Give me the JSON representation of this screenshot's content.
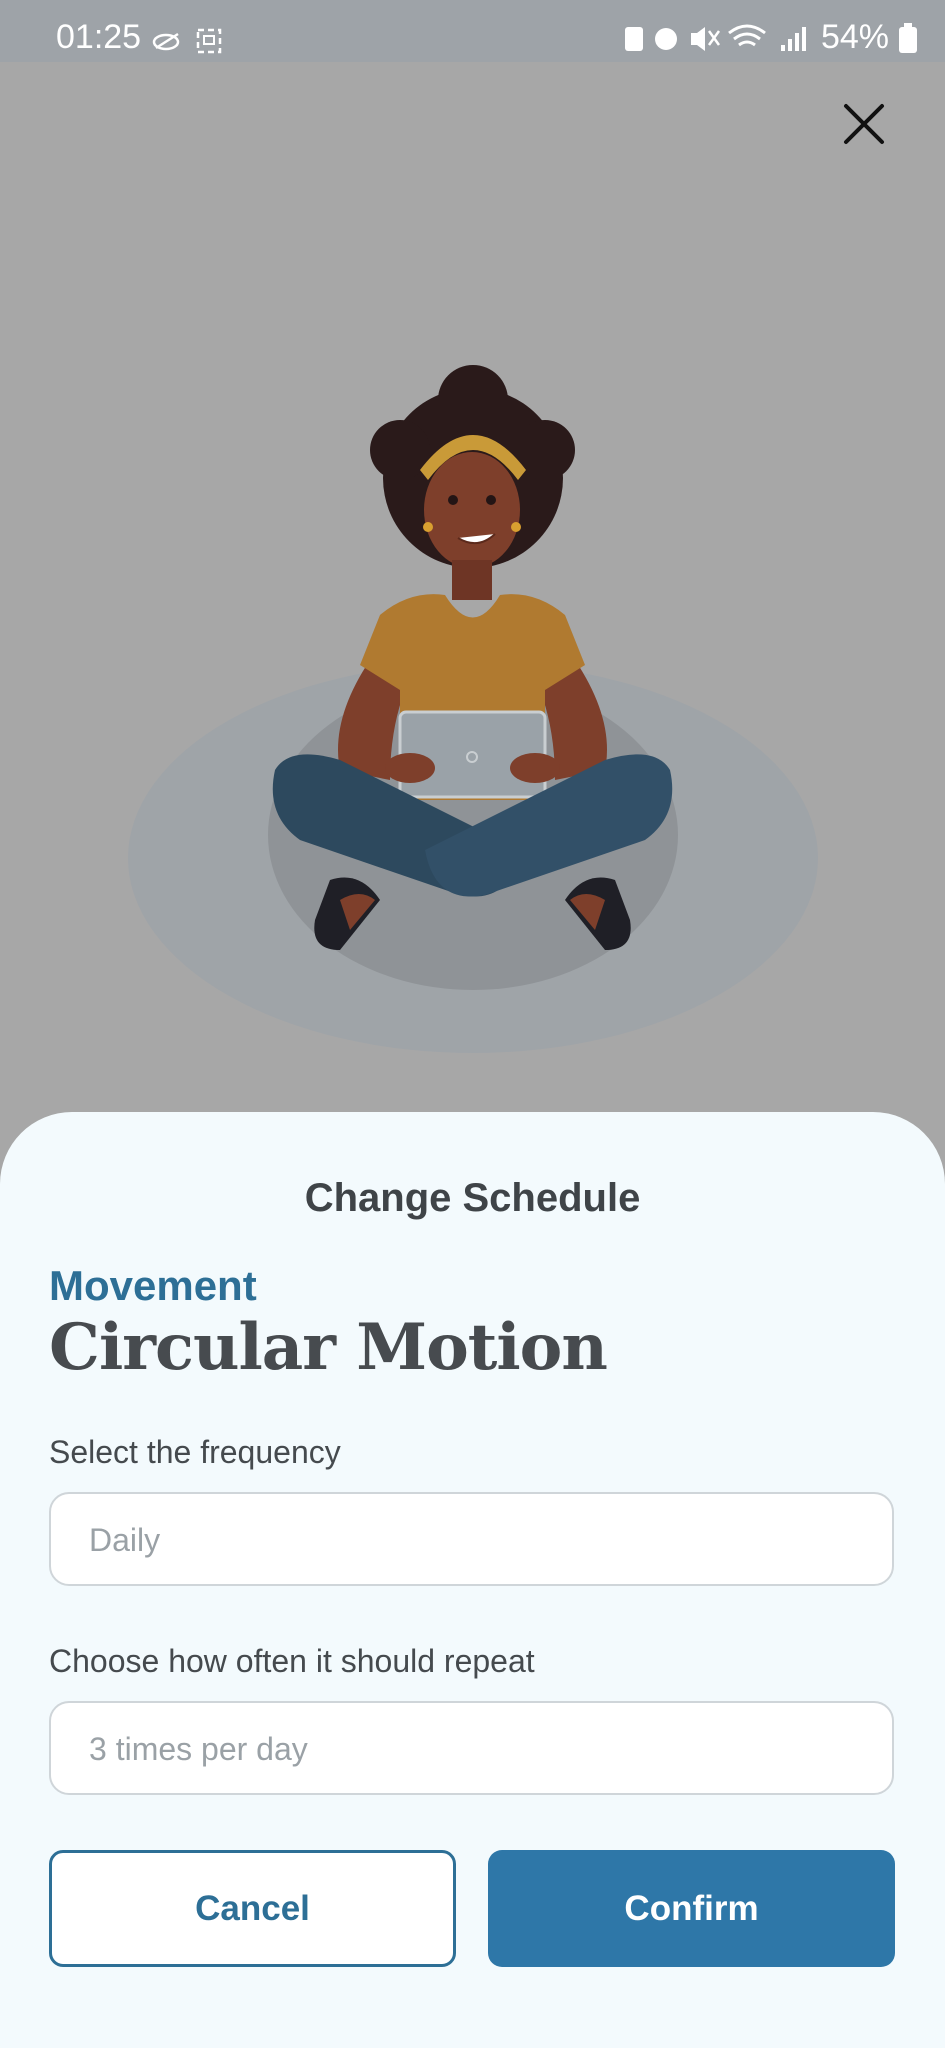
{
  "status_bar": {
    "time": "01:25",
    "battery": "54%"
  },
  "close": {
    "icon": "close-icon"
  },
  "sheet": {
    "title": "Change Schedule",
    "category": "Movement",
    "exercise": "Circular Motion",
    "frequency": {
      "label": "Select the frequency",
      "value": "Daily"
    },
    "repeat": {
      "label": "Choose how often it should repeat",
      "value": "3 times per day"
    },
    "cancel_label": "Cancel",
    "confirm_label": "Confirm"
  },
  "colors": {
    "accent": "#2e77a8",
    "backdrop": "#a7a7a7",
    "sheet": "#f3fafd"
  }
}
